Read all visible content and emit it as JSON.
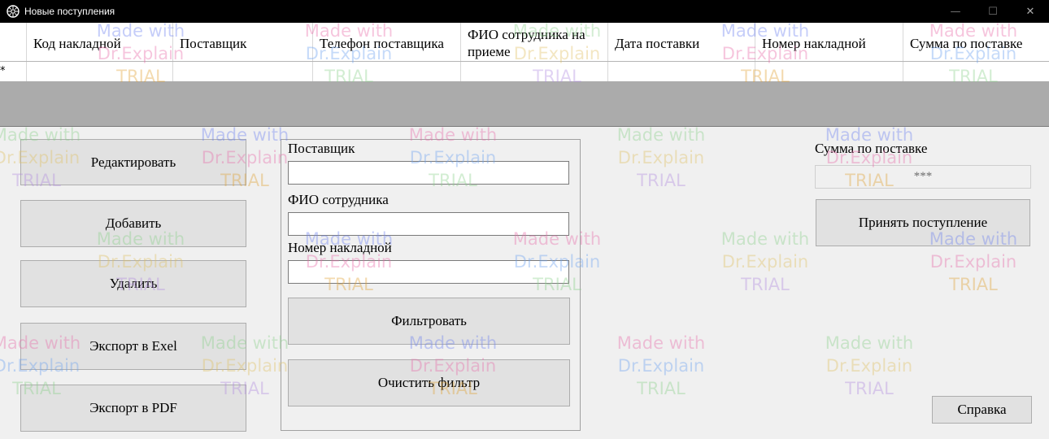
{
  "window": {
    "title": "Новые поступления",
    "minimize": "—",
    "maximize": "☐",
    "close": "✕"
  },
  "grid": {
    "columns": [
      "Код накладной",
      "Поставщик",
      "Телефон поставщика",
      "ФИО сотрудника на приеме",
      "Дата поставки",
      "Номер накладной",
      "Сумма по поставке"
    ],
    "new_row_marker": "*"
  },
  "buttons": {
    "edit": "Редактировать",
    "add": "Добавить",
    "delete": "Удалить",
    "export_excel": "Экспорт в Exel",
    "export_pdf": "Экспорт в PDF",
    "filter": "Фильтровать",
    "clear_filter": "Очистить фильтр",
    "accept": "Принять поступление",
    "help": "Справка"
  },
  "filters": {
    "supplier_label": "Поставщик",
    "supplier_value": "",
    "employee_label": "ФИО сотрудника",
    "employee_value": "",
    "invoice_label": "Номер накладной",
    "invoice_value": ""
  },
  "sum": {
    "label": "Сумма по поставке",
    "value": "***"
  },
  "watermark": {
    "line1": "Made with",
    "line2": "Dr.Explain",
    "line3": "TRIAL"
  }
}
